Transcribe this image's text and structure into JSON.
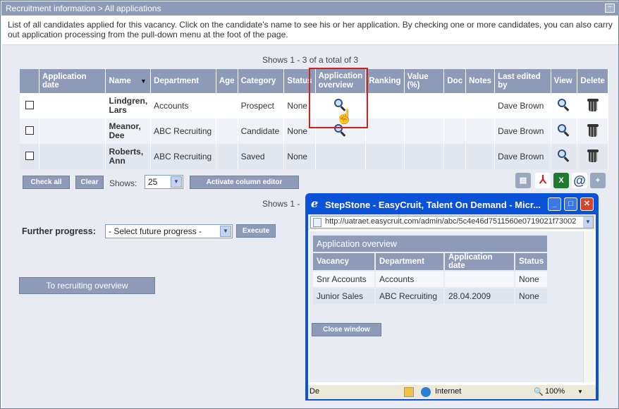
{
  "header": {
    "title": "Recruitment information > All applications",
    "collapse_symbol": "−"
  },
  "intro_text": "List of all candidates applied for this vacancy. Click on the candidate's name to see his or her application. By checking one or more candidates, you can also carry out application processing from the pull-down menu at the foot of the page.",
  "pagination": {
    "top_text": "Shows 1 - 3 of a total of 3",
    "bottom_text": "Shows 1 -"
  },
  "table": {
    "columns": [
      "",
      "Application date",
      "Name",
      "Department",
      "Age",
      "Category",
      "Status",
      "Application overview",
      "Ranking",
      "Value (%)",
      "Doc",
      "Notes",
      "Last edited by",
      "View",
      "Delete"
    ],
    "sort_indicator": "▼",
    "rows": [
      {
        "date": "",
        "name": "Lindgren, Lars",
        "department": "Accounts",
        "age": "",
        "category": "Prospect",
        "status": "None",
        "ranking": "",
        "value": "",
        "doc": "",
        "notes": "",
        "edited_by": "Dave Brown"
      },
      {
        "date": "",
        "name": "Meanor, Dee",
        "department": "ABC Recruiting",
        "age": "",
        "category": "Candidate",
        "status": "None",
        "ranking": "",
        "value": "",
        "doc": "",
        "notes": "",
        "edited_by": "Dave Brown"
      },
      {
        "date": "",
        "name": "Roberts, Ann",
        "department": "ABC Recruiting",
        "age": "",
        "category": "Saved",
        "status": "None",
        "ranking": "",
        "value": "",
        "doc": "",
        "notes": "",
        "edited_by": "Dave Brown"
      }
    ]
  },
  "controls": {
    "check_all": "Check all",
    "clear": "Clear",
    "shows_label": "Shows:",
    "shows_value": "25",
    "column_editor": "Activate column editor",
    "further_label": "Further progress:",
    "further_select": "- Select future progress -",
    "execute": "Execute",
    "to_overview": "To recruiting overview"
  },
  "export_icons": [
    "print-icon",
    "pdf-icon",
    "excel-icon",
    "email-icon",
    "print-add-icon"
  ],
  "popup": {
    "title": "StepStone - EasyCruit, Talent On Demand - Micr...",
    "address": "http://uatraet.easycruit.com/admin/abc/5c4e46d7511560e0719021f73002",
    "table_title": "Application overview",
    "columns": [
      "Vacancy",
      "Department",
      "Application date",
      "Status"
    ],
    "rows": [
      {
        "vacancy": "Snr Accounts",
        "department": "Accounts",
        "date": "",
        "status": "None"
      },
      {
        "vacancy": "Junior Sales",
        "department": "ABC Recruiting",
        "date": "28.04.2009",
        "status": "None"
      }
    ],
    "close_button": "Close window",
    "status_left": "De",
    "status_zone": "Internet",
    "zoom": "100%"
  },
  "colors": {
    "header_bg": "#8d9bb8",
    "highlight": "#cc2222",
    "xp_blue": "#0a52d8"
  }
}
